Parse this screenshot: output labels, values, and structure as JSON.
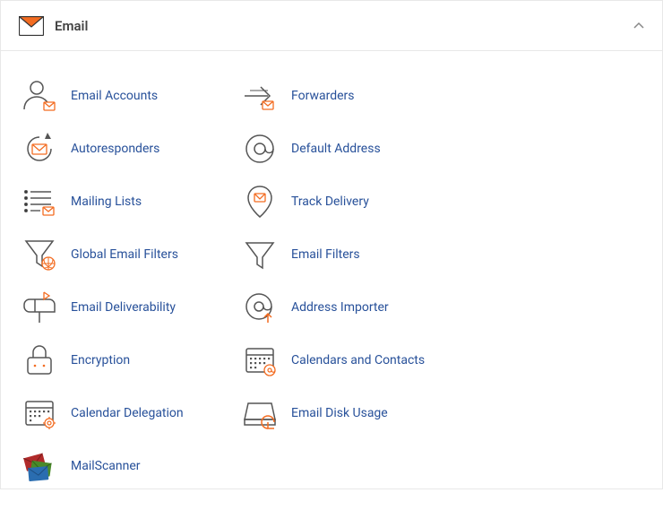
{
  "panel": {
    "title": "Email",
    "collapsed": false
  },
  "items": [
    {
      "label": "Email Accounts",
      "icon": "user-envelope-icon"
    },
    {
      "label": "Forwarders",
      "icon": "forward-arrow-icon"
    },
    {
      "label": "Autoresponders",
      "icon": "refresh-envelope-icon"
    },
    {
      "label": "Default Address",
      "icon": "at-symbol-icon"
    },
    {
      "label": "Mailing Lists",
      "icon": "list-envelope-icon"
    },
    {
      "label": "Track Delivery",
      "icon": "pin-envelope-icon"
    },
    {
      "label": "Global Email Filters",
      "icon": "funnel-globe-icon"
    },
    {
      "label": "Email Filters",
      "icon": "funnel-icon"
    },
    {
      "label": "Email Deliverability",
      "icon": "mailbox-icon"
    },
    {
      "label": "Address Importer",
      "icon": "at-download-icon"
    },
    {
      "label": "Encryption",
      "icon": "lock-icon"
    },
    {
      "label": "Calendars and Contacts",
      "icon": "calendar-at-icon"
    },
    {
      "label": "Calendar Delegation",
      "icon": "calendar-gear-icon"
    },
    {
      "label": "Email Disk Usage",
      "icon": "disk-usage-icon"
    },
    {
      "label": "MailScanner",
      "icon": "envelopes-stack-icon"
    }
  ]
}
